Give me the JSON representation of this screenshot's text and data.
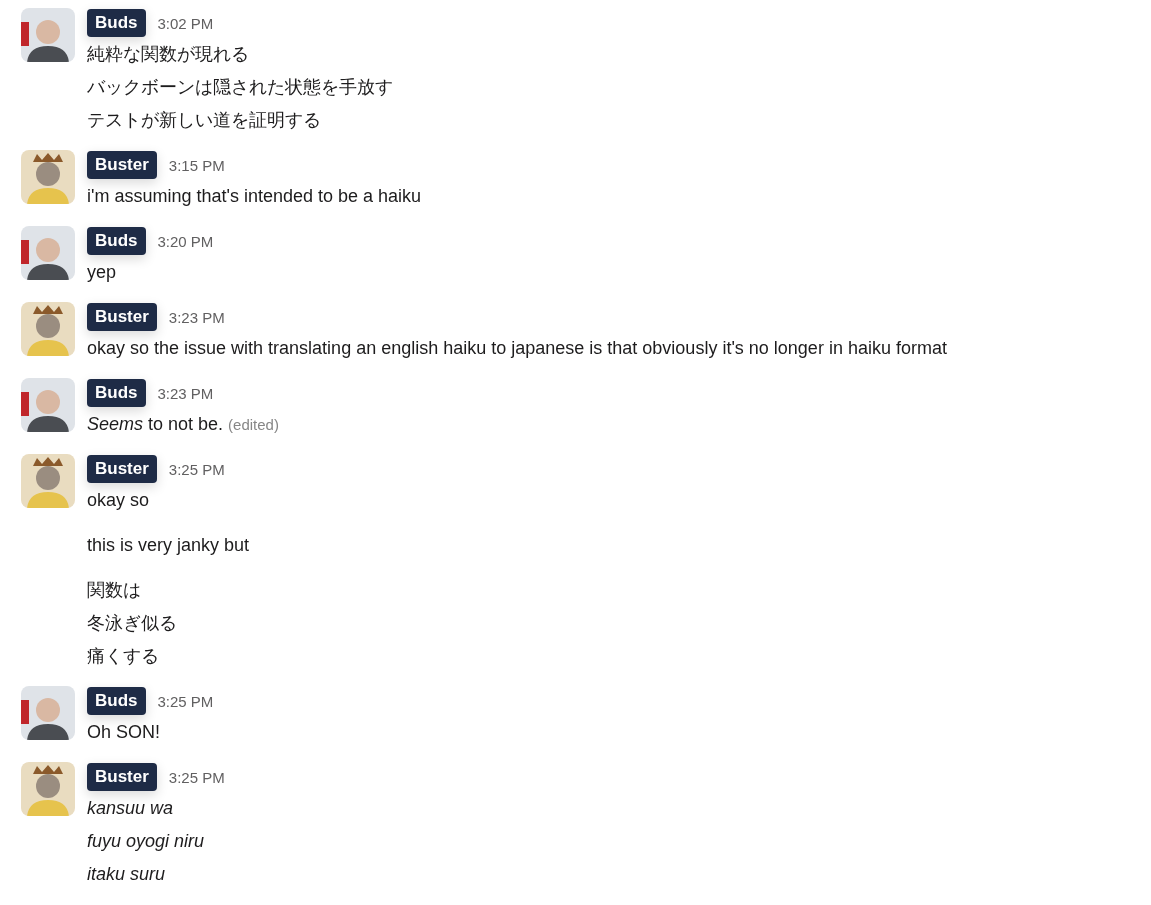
{
  "messages": [
    {
      "author": "Buds",
      "avatar": {
        "kind": "bald"
      },
      "time": "3:02 PM",
      "paragraphs": [
        [
          {
            "text": "純粋な関数が現れる",
            "italic": false
          },
          {
            "text": "バックボーンは隠された状態を手放す",
            "italic": false
          },
          {
            "text": "テストが新しい道を証明する",
            "italic": false
          }
        ]
      ]
    },
    {
      "author": "Buster",
      "avatar": {
        "kind": "crown"
      },
      "time": "3:15 PM",
      "paragraphs": [
        [
          {
            "text": "i'm assuming that's intended to be a haiku",
            "italic": false
          }
        ]
      ]
    },
    {
      "author": "Buds",
      "avatar": {
        "kind": "bald"
      },
      "time": "3:20 PM",
      "paragraphs": [
        [
          {
            "text": "yep",
            "italic": false
          }
        ]
      ]
    },
    {
      "author": "Buster",
      "avatar": {
        "kind": "crown"
      },
      "time": "3:23 PM",
      "paragraphs": [
        [
          {
            "text": "okay so the issue with translating an english haiku to japanese is that obviously it's no longer in haiku format",
            "italic": false
          }
        ]
      ]
    },
    {
      "author": "Buds",
      "avatar": {
        "kind": "bald"
      },
      "time": "3:23 PM",
      "paragraphs": [
        [
          {
            "text": "*Seems* to not be.",
            "italic": false,
            "edited": "(edited)"
          }
        ]
      ]
    },
    {
      "author": "Buster",
      "avatar": {
        "kind": "crown"
      },
      "time": "3:25 PM",
      "paragraphs": [
        [
          {
            "text": "okay so",
            "italic": false
          }
        ],
        [
          {
            "text": "this is very janky but",
            "italic": false
          }
        ],
        [
          {
            "text": "関数は",
            "italic": false
          },
          {
            "text": "冬泳ぎ似る",
            "italic": false
          },
          {
            "text": "痛くする",
            "italic": false
          }
        ]
      ]
    },
    {
      "author": "Buds",
      "avatar": {
        "kind": "bald"
      },
      "time": "3:25 PM",
      "paragraphs": [
        [
          {
            "text": "Oh SON!",
            "italic": false
          }
        ]
      ]
    },
    {
      "author": "Buster",
      "avatar": {
        "kind": "crown"
      },
      "time": "3:25 PM",
      "paragraphs": [
        [
          {
            "text": "kansuu wa",
            "italic": true
          },
          {
            "text": "fuyu oyogi niru",
            "italic": true
          },
          {
            "text": "itaku suru",
            "italic": true
          }
        ]
      ]
    }
  ]
}
